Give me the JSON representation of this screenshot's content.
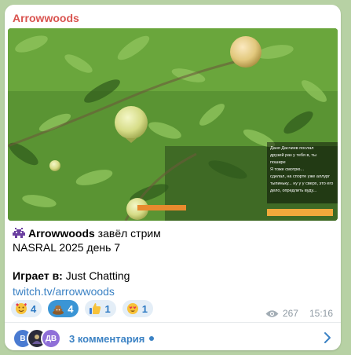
{
  "channel": {
    "name": "Arrowwoods"
  },
  "stream_overlay": {
    "chat_lines": [
      "Даня Дасчиев послал",
      "друзей раз у тебя в, ты",
      "пошире",
      "Я тоже смотрю...",
      "сделал, на спорте уже аллург",
      "тыпиньку... ну у у сверх, это его",
      "дело, опредлить вуду..."
    ]
  },
  "post": {
    "author": "Arrowwoods",
    "action": "завёл стрим",
    "title": "NASRAL 2025 день 7",
    "playing_label": "Играет в:",
    "playing_value": "Just Chatting",
    "link": "twitch.tv/arrowwoods"
  },
  "reactions": [
    {
      "emoji": "smiling-face-with-hearts",
      "count": "4",
      "active": false
    },
    {
      "emoji": "pile-of-poo",
      "count": "4",
      "active": true
    },
    {
      "emoji": "thumbs-up",
      "count": "1",
      "active": false
    },
    {
      "emoji": "heart-eyes",
      "count": "1",
      "active": false
    }
  ],
  "meta": {
    "views": "267",
    "time": "15:16"
  },
  "comments": {
    "label": "3 комментария",
    "avatars": [
      {
        "initials": "В",
        "color": "#4a7bd1"
      },
      {
        "initials": "",
        "color": "#2b2b3a"
      },
      {
        "initials": "ДВ",
        "color": "#8f6fd8"
      }
    ]
  },
  "colors": {
    "channel_name": "#d9534f",
    "link": "#3b82c4",
    "reaction_bg": "#e4eef7",
    "reaction_active": "#3a95d5"
  }
}
